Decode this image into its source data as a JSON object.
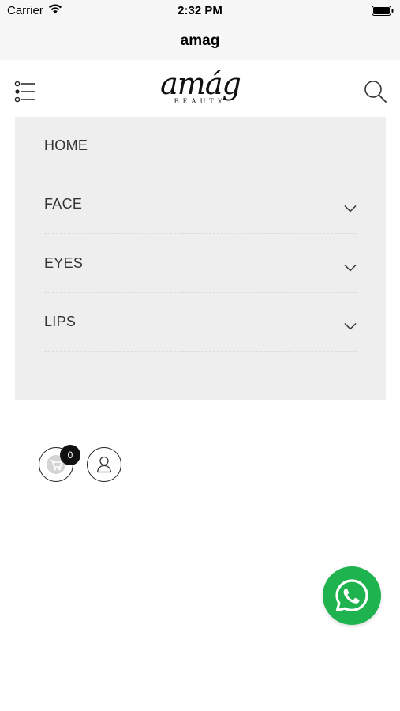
{
  "status_bar": {
    "carrier": "Carrier",
    "time": "2:32 PM"
  },
  "nav_bar": {
    "title": "amag"
  },
  "header": {
    "logo_script": "amág",
    "logo_sub": "BEAUTY"
  },
  "menu": {
    "items": [
      {
        "label": "HOME",
        "has_submenu": false
      },
      {
        "label": "FACE",
        "has_submenu": true
      },
      {
        "label": "EYES",
        "has_submenu": true
      },
      {
        "label": "LIPS",
        "has_submenu": true
      }
    ]
  },
  "cart": {
    "count": "0"
  },
  "colors": {
    "menu_panel_bg": "#eeeeee",
    "whatsapp_green": "#1eb34f",
    "badge_bg": "#111111"
  },
  "icons": [
    "wifi-icon",
    "battery-icon",
    "menu-list-icon",
    "search-icon",
    "chevron-down-icon",
    "cart-icon",
    "user-icon",
    "whatsapp-icon"
  ]
}
